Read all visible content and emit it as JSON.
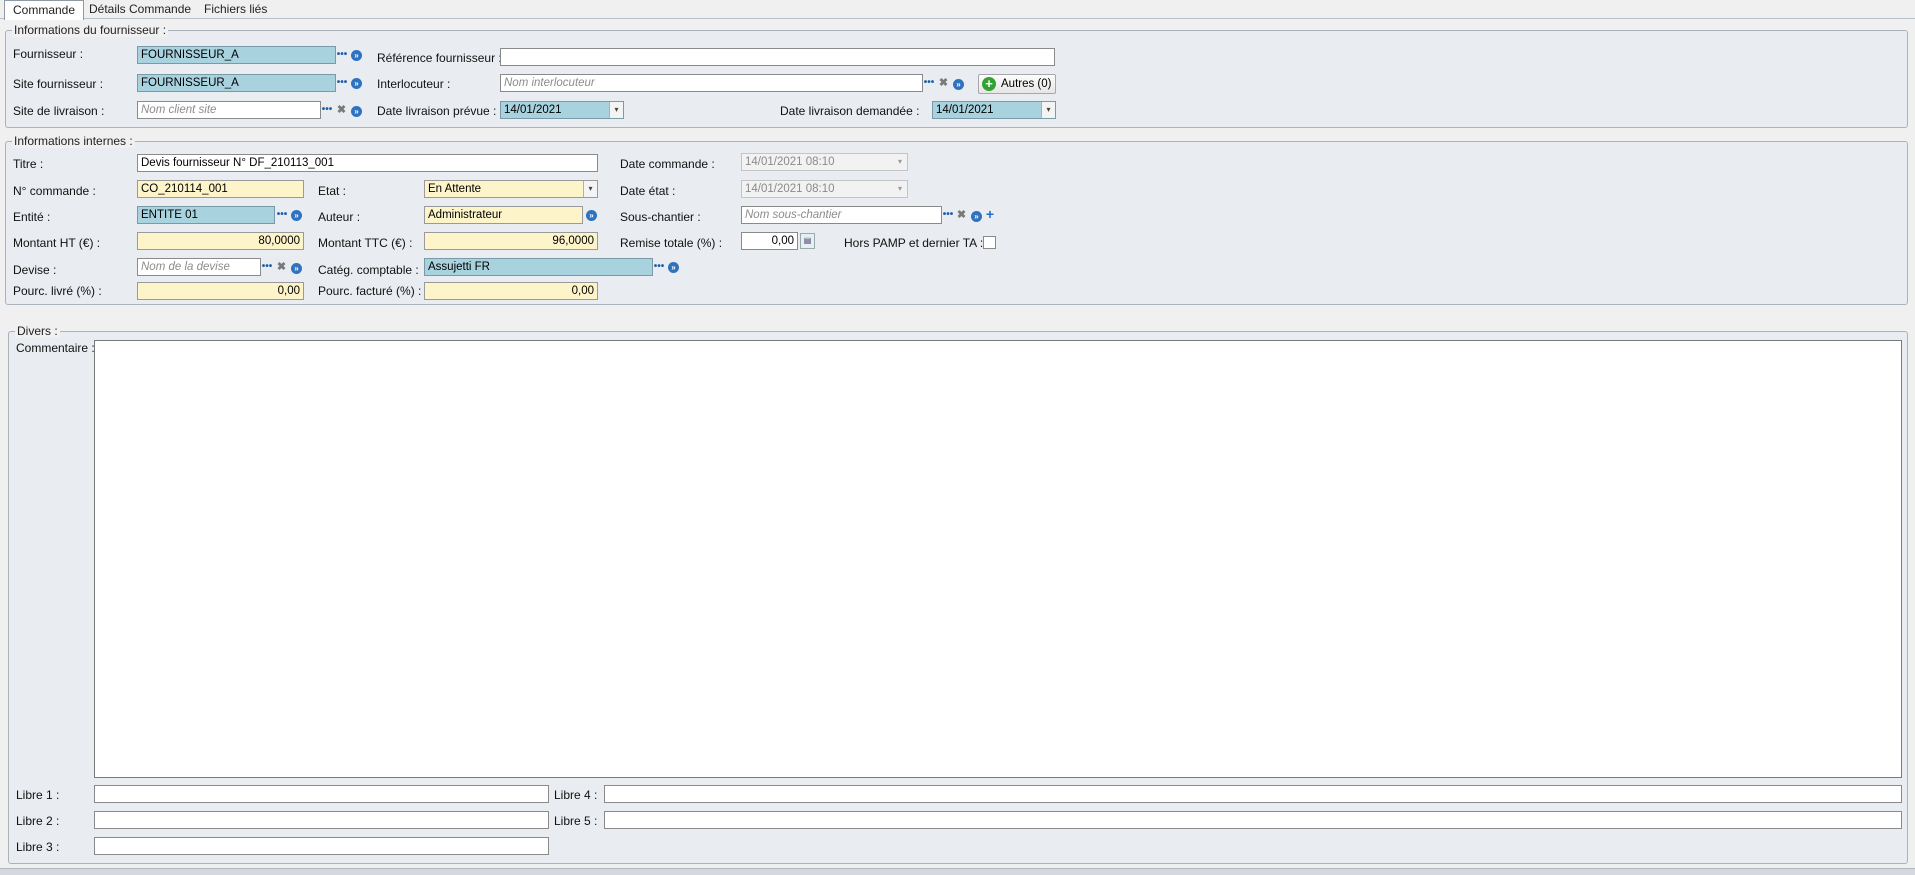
{
  "tabs": [
    {
      "label": "Commande",
      "active": true
    },
    {
      "label": "Détails Commande",
      "active": false
    },
    {
      "label": "Fichiers liés",
      "active": false
    }
  ],
  "supplier_group": {
    "title": "Informations du fournisseur :",
    "fournisseur_label": "Fournisseur :",
    "fournisseur_value": "FOURNISSEUR_A",
    "site_label": "Site fournisseur :",
    "site_value": "FOURNISSEUR_A",
    "livraison_label": "Site de livraison :",
    "livraison_placeholder": "Nom client site",
    "reference_label": "Référence fournisseur :",
    "reference_value": "",
    "interlocuteur_label": "Interlocuteur :",
    "interlocuteur_placeholder": "Nom interlocuteur",
    "autres_label": "Autres (0)",
    "date_prevue_label": "Date livraison prévue :",
    "date_prevue_value": "14/01/2021",
    "date_demandee_label": "Date livraison demandée :",
    "date_demandee_value": "14/01/2021"
  },
  "internal_group": {
    "title": "Informations internes :",
    "titre_label": "Titre :",
    "titre_value": "Devis fournisseur N° DF_210113_001",
    "date_commande_label": "Date commande :",
    "date_commande_value": "14/01/2021 08:10",
    "num_commande_label": "N° commande :",
    "num_commande_value": "CO_210114_001",
    "etat_label": "Etat :",
    "etat_value": "En Attente",
    "date_etat_label": "Date état :",
    "date_etat_value": "14/01/2021 08:10",
    "entite_label": "Entité :",
    "entite_value": "ENTITE 01",
    "auteur_label": "Auteur :",
    "auteur_value": "Administrateur",
    "sous_chantier_label": "Sous-chantier :",
    "sous_chantier_placeholder": "Nom sous-chantier",
    "montant_ht_label": "Montant HT (€) :",
    "montant_ht_value": "80,0000",
    "montant_ttc_label": "Montant TTC (€) :",
    "montant_ttc_value": "96,0000",
    "remise_label": "Remise totale (%) :",
    "remise_value": "0,00",
    "hors_pamp_label": "Hors PAMP et dernier TA :",
    "devise_label": "Devise :",
    "devise_placeholder": "Nom de la devise",
    "categ_label": "Catég. comptable :",
    "categ_value": "Assujetti FR",
    "livre_label": "Pourc. livré (%) :",
    "livre_value": "0,00",
    "facture_label": "Pourc. facturé (%) :",
    "facture_value": "0,00"
  },
  "divers_group": {
    "title": "Divers :",
    "commentaire_label": "Commentaire :",
    "libre1_label": "Libre 1 :",
    "libre2_label": "Libre 2 :",
    "libre3_label": "Libre 3 :",
    "libre4_label": "Libre 4 :",
    "libre5_label": "Libre 5 :"
  },
  "icons": {
    "ellipsis": "•••",
    "clear": "✖",
    "go": "»",
    "plus": "+",
    "dropdown": "▾"
  }
}
